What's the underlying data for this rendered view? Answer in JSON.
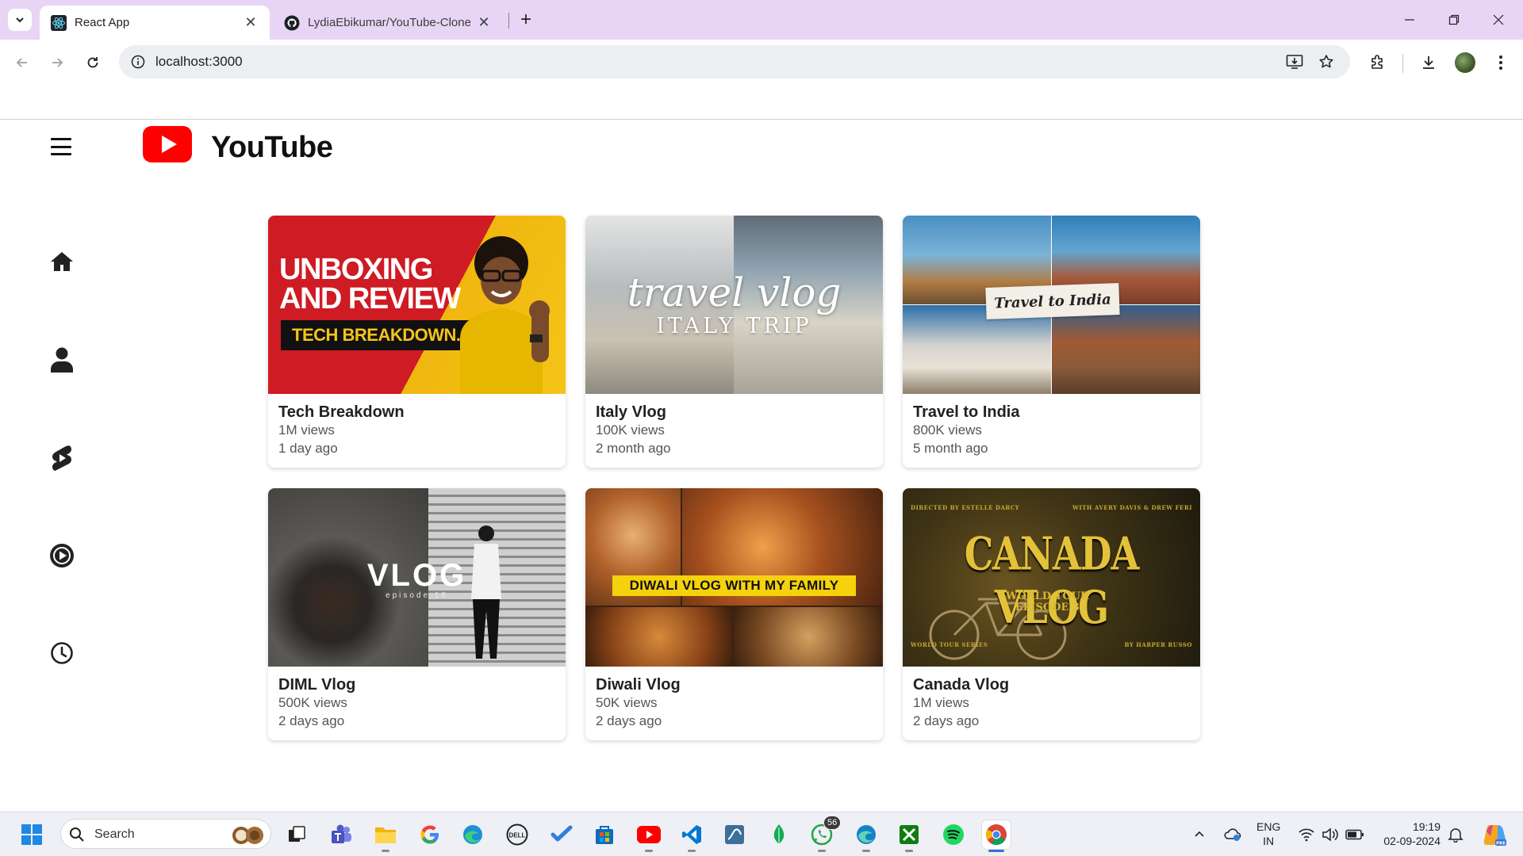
{
  "browser": {
    "tabs": [
      {
        "label": "React App",
        "active": true,
        "icon": "react-icon"
      },
      {
        "label": "LydiaEbikumar/YouTube-Clone",
        "active": false,
        "icon": "github-icon"
      }
    ],
    "url": "localhost:3000"
  },
  "app": {
    "logo_text": "YouTube",
    "brand_color": "#ff0000",
    "sidebar": [
      {
        "name": "home",
        "icon": "home-icon"
      },
      {
        "name": "profile",
        "icon": "user-icon"
      },
      {
        "name": "shorts",
        "icon": "shorts-icon"
      },
      {
        "name": "subscriptions",
        "icon": "play-circle-icon"
      },
      {
        "name": "history",
        "icon": "clock-icon"
      }
    ],
    "videos": [
      {
        "title": "Tech Breakdown",
        "views": "1M views",
        "ago": "1 day ago",
        "thumb": {
          "line1": "UNBOXING",
          "line2": "AND REVIEW",
          "badge": "TECH BREAKDOWN."
        }
      },
      {
        "title": "Italy Vlog",
        "views": "100K views",
        "ago": "2 month ago",
        "thumb": {
          "script": "travel vlog",
          "sub": "ITALY TRIP"
        }
      },
      {
        "title": "Travel to India",
        "views": "800K views",
        "ago": "5 month ago",
        "thumb": {
          "tape": "Travel to India"
        }
      },
      {
        "title": "DIML Vlog",
        "views": "500K views",
        "ago": "2 days ago",
        "thumb": {
          "text": "VLOG",
          "sub": "episode 18"
        }
      },
      {
        "title": "Diwali Vlog",
        "views": "50K views",
        "ago": "2 days ago",
        "thumb": {
          "banner": "DIWALI VLOG WITH MY FAMILY"
        }
      },
      {
        "title": "Canada Vlog",
        "views": "1M views",
        "ago": "2 days ago",
        "thumb": {
          "title": "CANADA VLOG",
          "tour1": "WORLD TOUR",
          "tour2": "EPISODE 3",
          "credit_tl": "DIRECTED BY ESTELLE DARCY",
          "credit_tr": "WITH AVERY DAVIS & DREW FERI",
          "credit_bl": "WORLD TOUR SERIES",
          "credit_br": "BY HARPER RUSSO"
        }
      }
    ]
  },
  "taskbar": {
    "search_placeholder": "Search",
    "whatsapp_badge": "56",
    "lang_line1": "ENG",
    "lang_line2": "IN",
    "time": "19:19",
    "date": "02-09-2024"
  }
}
